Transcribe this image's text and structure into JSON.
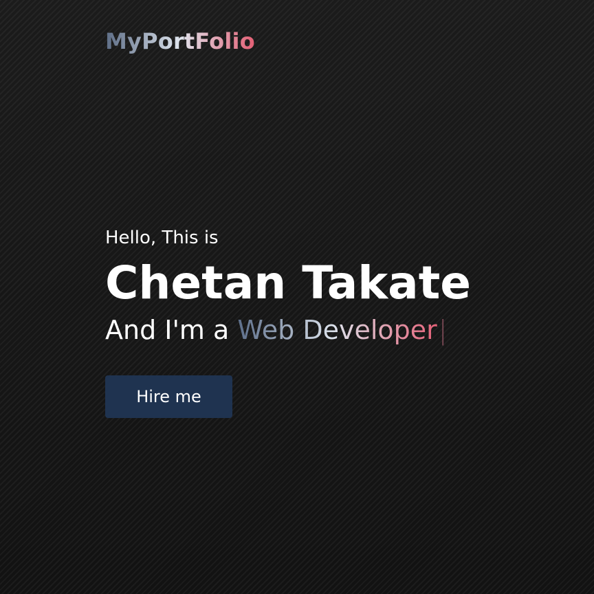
{
  "header": {
    "logo": "MyPortFolio"
  },
  "hero": {
    "greeting": "Hello, This is",
    "name": "Chetan Takate",
    "role_prefix": "And I'm a",
    "role": "Web Developer",
    "cursor": "|",
    "cta_label": "Hire me"
  },
  "colors": {
    "background": "#151515",
    "button": "#1f3350",
    "gradient_start": "#5c6e8a",
    "gradient_mid": "#dce3ec",
    "gradient_end": "#e56178"
  }
}
